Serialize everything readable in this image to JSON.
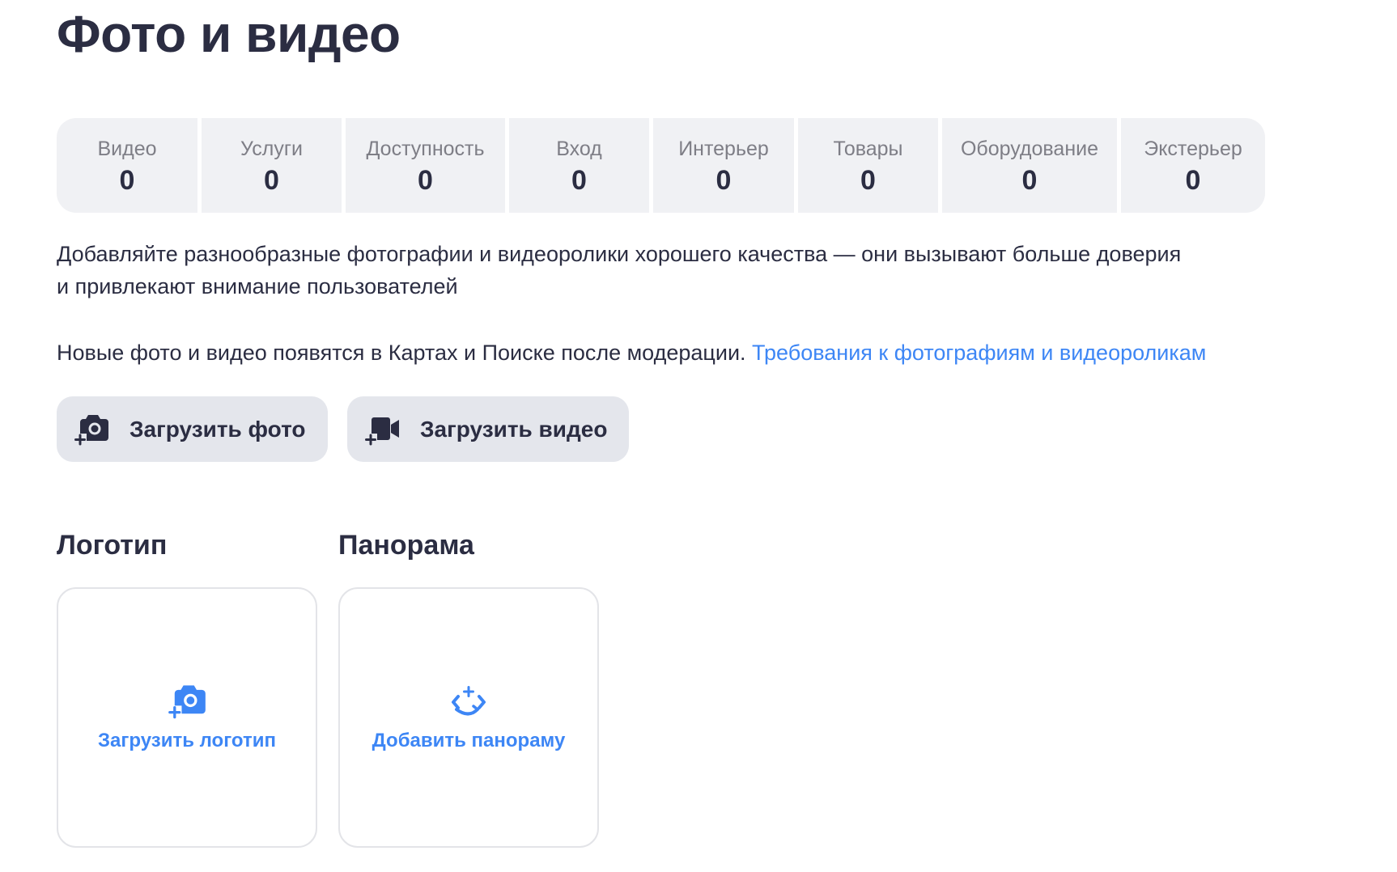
{
  "page": {
    "title": "Фото и видео"
  },
  "stats": [
    {
      "label": "Видео",
      "value": "0"
    },
    {
      "label": "Услуги",
      "value": "0"
    },
    {
      "label": "Доступность",
      "value": "0"
    },
    {
      "label": "Вход",
      "value": "0"
    },
    {
      "label": "Интерьер",
      "value": "0"
    },
    {
      "label": "Товары",
      "value": "0"
    },
    {
      "label": "Оборудование",
      "value": "0"
    },
    {
      "label": "Экстерьер",
      "value": "0"
    }
  ],
  "description": {
    "line1": "Добавляйте разнообразные фотографии и видеоролики хорошего качества — они вызывают больше доверия",
    "line2": "и привлекают внимание пользователей"
  },
  "moderation": {
    "text": "Новые фото и видео появятся в Картах и Поиске после модерации. ",
    "link": "Требования к фотографиям и видеороликам"
  },
  "buttons": {
    "upload_photo": {
      "label": "Загрузить фото",
      "icon": "add-camera-icon"
    },
    "upload_video": {
      "label": "Загрузить видео",
      "icon": "add-video-camera-icon"
    }
  },
  "logo": {
    "title": "Логотип",
    "action": "Загрузить логотип",
    "icon": "add-camera-icon"
  },
  "panorama": {
    "title": "Панорама",
    "action": "Добавить панораму",
    "icon": "panorama-icon"
  },
  "colors": {
    "text": "#2b2d42",
    "muted": "#7e7e86",
    "accent": "#3d86f5",
    "tile_bg": "#f0f1f4",
    "button_bg": "#e4e6ec"
  }
}
